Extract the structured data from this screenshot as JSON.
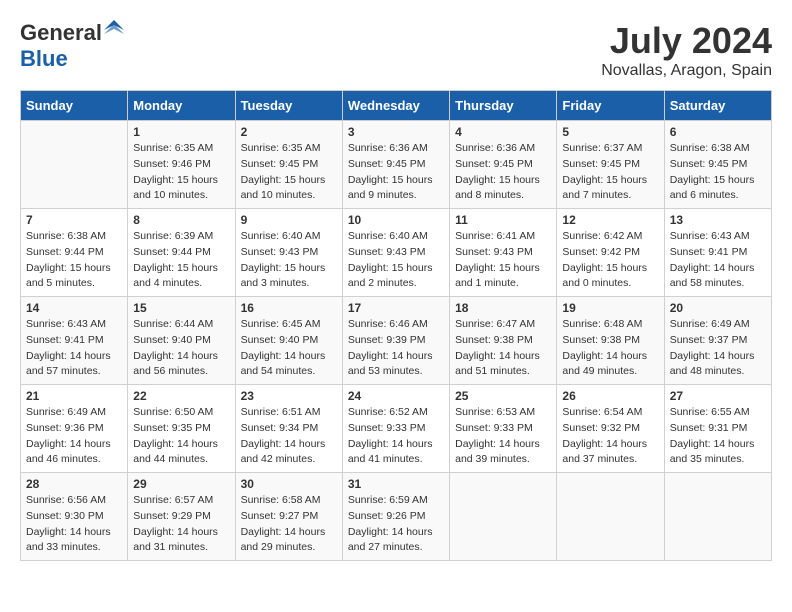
{
  "header": {
    "logo_general": "General",
    "logo_blue": "Blue",
    "month_year": "July 2024",
    "location": "Novallas, Aragon, Spain"
  },
  "weekdays": [
    "Sunday",
    "Monday",
    "Tuesday",
    "Wednesday",
    "Thursday",
    "Friday",
    "Saturday"
  ],
  "weeks": [
    [
      {
        "day": "",
        "sunrise": "",
        "sunset": "",
        "daylight": ""
      },
      {
        "day": "1",
        "sunrise": "Sunrise: 6:35 AM",
        "sunset": "Sunset: 9:46 PM",
        "daylight": "Daylight: 15 hours and 10 minutes."
      },
      {
        "day": "2",
        "sunrise": "Sunrise: 6:35 AM",
        "sunset": "Sunset: 9:45 PM",
        "daylight": "Daylight: 15 hours and 10 minutes."
      },
      {
        "day": "3",
        "sunrise": "Sunrise: 6:36 AM",
        "sunset": "Sunset: 9:45 PM",
        "daylight": "Daylight: 15 hours and 9 minutes."
      },
      {
        "day": "4",
        "sunrise": "Sunrise: 6:36 AM",
        "sunset": "Sunset: 9:45 PM",
        "daylight": "Daylight: 15 hours and 8 minutes."
      },
      {
        "day": "5",
        "sunrise": "Sunrise: 6:37 AM",
        "sunset": "Sunset: 9:45 PM",
        "daylight": "Daylight: 15 hours and 7 minutes."
      },
      {
        "day": "6",
        "sunrise": "Sunrise: 6:38 AM",
        "sunset": "Sunset: 9:45 PM",
        "daylight": "Daylight: 15 hours and 6 minutes."
      }
    ],
    [
      {
        "day": "7",
        "sunrise": "Sunrise: 6:38 AM",
        "sunset": "Sunset: 9:44 PM",
        "daylight": "Daylight: 15 hours and 5 minutes."
      },
      {
        "day": "8",
        "sunrise": "Sunrise: 6:39 AM",
        "sunset": "Sunset: 9:44 PM",
        "daylight": "Daylight: 15 hours and 4 minutes."
      },
      {
        "day": "9",
        "sunrise": "Sunrise: 6:40 AM",
        "sunset": "Sunset: 9:43 PM",
        "daylight": "Daylight: 15 hours and 3 minutes."
      },
      {
        "day": "10",
        "sunrise": "Sunrise: 6:40 AM",
        "sunset": "Sunset: 9:43 PM",
        "daylight": "Daylight: 15 hours and 2 minutes."
      },
      {
        "day": "11",
        "sunrise": "Sunrise: 6:41 AM",
        "sunset": "Sunset: 9:43 PM",
        "daylight": "Daylight: 15 hours and 1 minute."
      },
      {
        "day": "12",
        "sunrise": "Sunrise: 6:42 AM",
        "sunset": "Sunset: 9:42 PM",
        "daylight": "Daylight: 15 hours and 0 minutes."
      },
      {
        "day": "13",
        "sunrise": "Sunrise: 6:43 AM",
        "sunset": "Sunset: 9:41 PM",
        "daylight": "Daylight: 14 hours and 58 minutes."
      }
    ],
    [
      {
        "day": "14",
        "sunrise": "Sunrise: 6:43 AM",
        "sunset": "Sunset: 9:41 PM",
        "daylight": "Daylight: 14 hours and 57 minutes."
      },
      {
        "day": "15",
        "sunrise": "Sunrise: 6:44 AM",
        "sunset": "Sunset: 9:40 PM",
        "daylight": "Daylight: 14 hours and 56 minutes."
      },
      {
        "day": "16",
        "sunrise": "Sunrise: 6:45 AM",
        "sunset": "Sunset: 9:40 PM",
        "daylight": "Daylight: 14 hours and 54 minutes."
      },
      {
        "day": "17",
        "sunrise": "Sunrise: 6:46 AM",
        "sunset": "Sunset: 9:39 PM",
        "daylight": "Daylight: 14 hours and 53 minutes."
      },
      {
        "day": "18",
        "sunrise": "Sunrise: 6:47 AM",
        "sunset": "Sunset: 9:38 PM",
        "daylight": "Daylight: 14 hours and 51 minutes."
      },
      {
        "day": "19",
        "sunrise": "Sunrise: 6:48 AM",
        "sunset": "Sunset: 9:38 PM",
        "daylight": "Daylight: 14 hours and 49 minutes."
      },
      {
        "day": "20",
        "sunrise": "Sunrise: 6:49 AM",
        "sunset": "Sunset: 9:37 PM",
        "daylight": "Daylight: 14 hours and 48 minutes."
      }
    ],
    [
      {
        "day": "21",
        "sunrise": "Sunrise: 6:49 AM",
        "sunset": "Sunset: 9:36 PM",
        "daylight": "Daylight: 14 hours and 46 minutes."
      },
      {
        "day": "22",
        "sunrise": "Sunrise: 6:50 AM",
        "sunset": "Sunset: 9:35 PM",
        "daylight": "Daylight: 14 hours and 44 minutes."
      },
      {
        "day": "23",
        "sunrise": "Sunrise: 6:51 AM",
        "sunset": "Sunset: 9:34 PM",
        "daylight": "Daylight: 14 hours and 42 minutes."
      },
      {
        "day": "24",
        "sunrise": "Sunrise: 6:52 AM",
        "sunset": "Sunset: 9:33 PM",
        "daylight": "Daylight: 14 hours and 41 minutes."
      },
      {
        "day": "25",
        "sunrise": "Sunrise: 6:53 AM",
        "sunset": "Sunset: 9:33 PM",
        "daylight": "Daylight: 14 hours and 39 minutes."
      },
      {
        "day": "26",
        "sunrise": "Sunrise: 6:54 AM",
        "sunset": "Sunset: 9:32 PM",
        "daylight": "Daylight: 14 hours and 37 minutes."
      },
      {
        "day": "27",
        "sunrise": "Sunrise: 6:55 AM",
        "sunset": "Sunset: 9:31 PM",
        "daylight": "Daylight: 14 hours and 35 minutes."
      }
    ],
    [
      {
        "day": "28",
        "sunrise": "Sunrise: 6:56 AM",
        "sunset": "Sunset: 9:30 PM",
        "daylight": "Daylight: 14 hours and 33 minutes."
      },
      {
        "day": "29",
        "sunrise": "Sunrise: 6:57 AM",
        "sunset": "Sunset: 9:29 PM",
        "daylight": "Daylight: 14 hours and 31 minutes."
      },
      {
        "day": "30",
        "sunrise": "Sunrise: 6:58 AM",
        "sunset": "Sunset: 9:27 PM",
        "daylight": "Daylight: 14 hours and 29 minutes."
      },
      {
        "day": "31",
        "sunrise": "Sunrise: 6:59 AM",
        "sunset": "Sunset: 9:26 PM",
        "daylight": "Daylight: 14 hours and 27 minutes."
      },
      {
        "day": "",
        "sunrise": "",
        "sunset": "",
        "daylight": ""
      },
      {
        "day": "",
        "sunrise": "",
        "sunset": "",
        "daylight": ""
      },
      {
        "day": "",
        "sunrise": "",
        "sunset": "",
        "daylight": ""
      }
    ]
  ]
}
